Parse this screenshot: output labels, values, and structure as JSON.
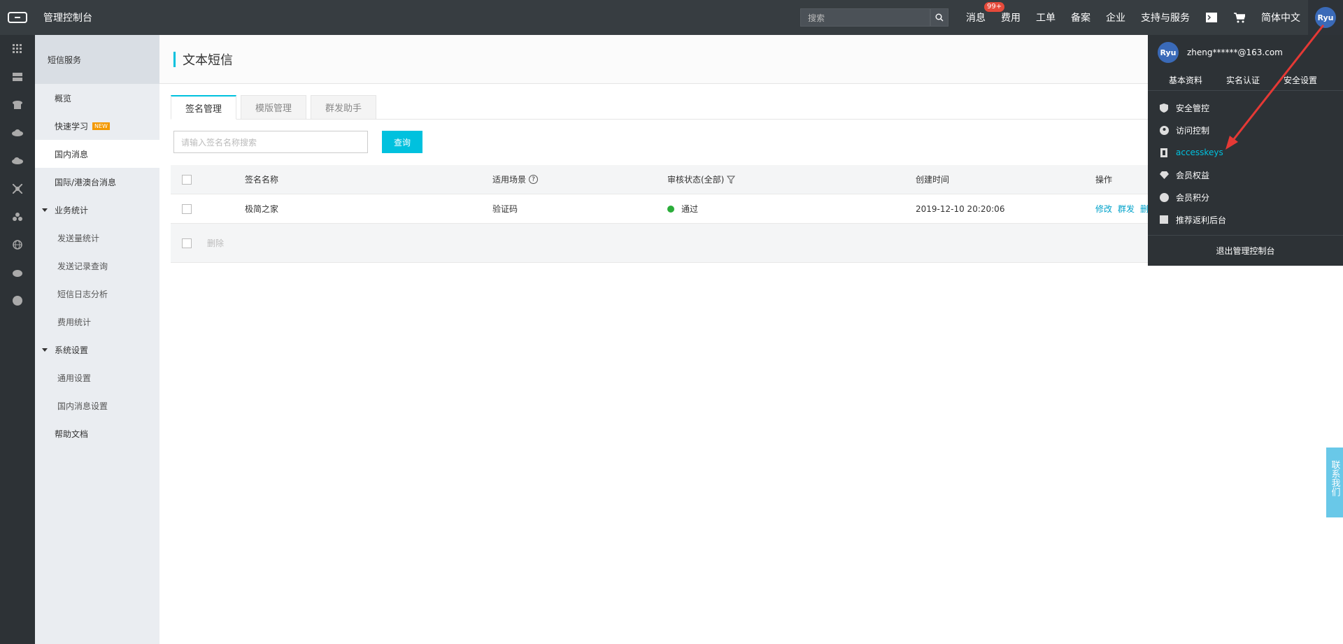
{
  "topbar": {
    "title": "管理控制台",
    "search_placeholder": "搜索",
    "links": [
      {
        "label": "消息",
        "badge": "99+"
      },
      {
        "label": "费用"
      },
      {
        "label": "工单"
      },
      {
        "label": "备案"
      },
      {
        "label": "企业"
      },
      {
        "label": "支持与服务"
      }
    ],
    "language": "简体中文",
    "avatar_text": "Ryu"
  },
  "subnav": {
    "header": "短信服务",
    "items": [
      {
        "label": "概览"
      },
      {
        "label": "快速学习",
        "badge": "NEW"
      },
      {
        "label": "国内消息"
      },
      {
        "label": "国际/港澳台消息"
      },
      {
        "label": "业务统计"
      },
      {
        "label": "发送量统计"
      },
      {
        "label": "发送记录查询"
      },
      {
        "label": "短信日志分析"
      },
      {
        "label": "费用统计"
      },
      {
        "label": "系统设置"
      },
      {
        "label": "通用设置"
      },
      {
        "label": "国内消息设置"
      },
      {
        "label": "帮助文档"
      }
    ]
  },
  "main": {
    "title": "文本短信",
    "tabs": [
      "签名管理",
      "模版管理",
      "群发助手"
    ],
    "search_placeholder": "请输入签名名称搜索",
    "query_label": "查询",
    "table": {
      "headers": {
        "name": "签名名称",
        "scene": "适用场景",
        "status": "审核状态(全部)",
        "time": "创建时间",
        "op": "操作"
      },
      "rows": [
        {
          "name": "极简之家",
          "scene": "验证码",
          "status": "通过",
          "time": "2019-12-10 20:20:06",
          "ops": [
            "修改",
            "群发",
            "删"
          ]
        }
      ],
      "footer_delete": "删除"
    }
  },
  "dropdown": {
    "email": "zheng******@163.com",
    "links": [
      "基本资料",
      "实名认证",
      "安全设置"
    ],
    "menu": [
      "安全管控",
      "访问控制",
      "accesskeys",
      "会员权益",
      "会员积分",
      "推荐返利后台"
    ],
    "logout": "退出管理控制台"
  },
  "contact": "联系我们",
  "colors": {
    "accent": "#00c1de",
    "status_ok": "#2bad3a",
    "arrow": "#e53935"
  }
}
